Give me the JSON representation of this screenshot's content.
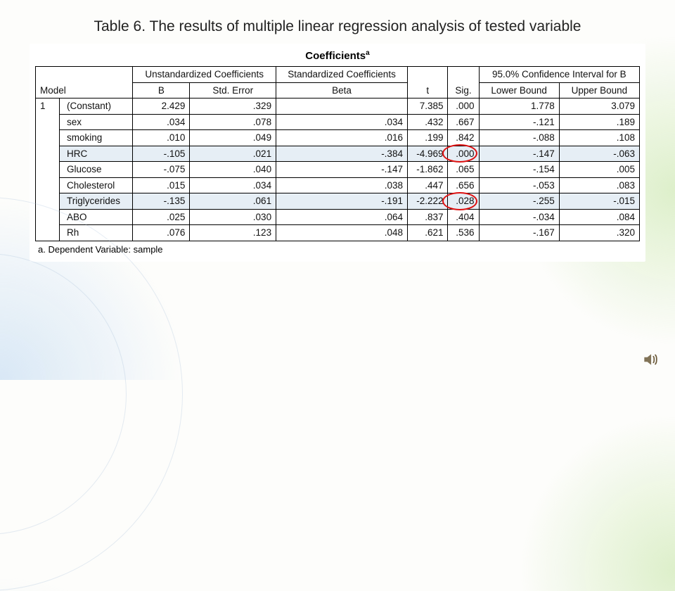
{
  "title": "Table 6. The results of multiple linear regression analysis of tested variable",
  "caption": "Coefficients",
  "caption_sup": "a",
  "head": {
    "unstd": "Unstandardized Coefficients",
    "std": "Standardized Coefficients",
    "ci": "95.0% Confidence Interval for B",
    "model": "Model",
    "B": "B",
    "se": "Std. Error",
    "beta": "Beta",
    "t": "t",
    "sig": "Sig.",
    "lb": "Lower Bound",
    "ub": "Upper Bound"
  },
  "model_label": "1",
  "rows": [
    {
      "var": "(Constant)",
      "B": "2.429",
      "se": ".329",
      "beta": "",
      "t": "7.385",
      "sig": ".000",
      "lb": "1.778",
      "ub": "3.079",
      "hl": false
    },
    {
      "var": "sex",
      "B": ".034",
      "se": ".078",
      "beta": ".034",
      "t": ".432",
      "sig": ".667",
      "lb": "-.121",
      "ub": ".189",
      "hl": false
    },
    {
      "var": "smoking",
      "B": ".010",
      "se": ".049",
      "beta": ".016",
      "t": ".199",
      "sig": ".842",
      "lb": "-.088",
      "ub": ".108",
      "hl": false
    },
    {
      "var": "HRC",
      "B": "-.105",
      "se": ".021",
      "beta": "-.384",
      "t": "-4.969",
      "sig": ".000",
      "lb": "-.147",
      "ub": "-.063",
      "hl": true
    },
    {
      "var": "Glucose",
      "B": "-.075",
      "se": ".040",
      "beta": "-.147",
      "t": "-1.862",
      "sig": ".065",
      "lb": "-.154",
      "ub": ".005",
      "hl": false
    },
    {
      "var": "Cholesterol",
      "B": ".015",
      "se": ".034",
      "beta": ".038",
      "t": ".447",
      "sig": ".656",
      "lb": "-.053",
      "ub": ".083",
      "hl": false
    },
    {
      "var": "Triglycerides",
      "B": "-.135",
      "se": ".061",
      "beta": "-.191",
      "t": "-2.222",
      "sig": ".028",
      "lb": "-.255",
      "ub": "-.015",
      "hl": true
    },
    {
      "var": "ABO",
      "B": ".025",
      "se": ".030",
      "beta": ".064",
      "t": ".837",
      "sig": ".404",
      "lb": "-.034",
      "ub": ".084",
      "hl": false
    },
    {
      "var": "Rh",
      "B": ".076",
      "se": ".123",
      "beta": ".048",
      "t": ".621",
      "sig": ".536",
      "lb": "-.167",
      "ub": ".320",
      "hl": false
    }
  ],
  "footnote": "a. Dependent Variable: sample",
  "circles": [
    {
      "row": 3,
      "col": "sig"
    },
    {
      "row": 6,
      "col": "sig"
    }
  ],
  "chart_data": {
    "type": "table",
    "title": "Coefficients (multiple linear regression, dependent variable: sample)",
    "columns": [
      "Variable",
      "B",
      "Std. Error",
      "Beta",
      "t",
      "Sig.",
      "Lower Bound",
      "Upper Bound"
    ],
    "rows": [
      [
        "(Constant)",
        2.429,
        0.329,
        null,
        7.385,
        0.0,
        1.778,
        3.079
      ],
      [
        "sex",
        0.034,
        0.078,
        0.034,
        0.432,
        0.667,
        -0.121,
        0.189
      ],
      [
        "smoking",
        0.01,
        0.049,
        0.016,
        0.199,
        0.842,
        -0.088,
        0.108
      ],
      [
        "HRC",
        -0.105,
        0.021,
        -0.384,
        -4.969,
        0.0,
        -0.147,
        -0.063
      ],
      [
        "Glucose",
        -0.075,
        0.04,
        -0.147,
        -1.862,
        0.065,
        -0.154,
        0.005
      ],
      [
        "Cholesterol",
        0.015,
        0.034,
        0.038,
        0.447,
        0.656,
        -0.053,
        0.083
      ],
      [
        "Triglycerides",
        -0.135,
        0.061,
        -0.191,
        -2.222,
        0.028,
        -0.255,
        -0.015
      ],
      [
        "ABO",
        0.025,
        0.03,
        0.064,
        0.837,
        0.404,
        -0.034,
        0.084
      ],
      [
        "Rh",
        0.076,
        0.123,
        0.048,
        0.621,
        0.536,
        -0.167,
        0.32
      ]
    ]
  }
}
